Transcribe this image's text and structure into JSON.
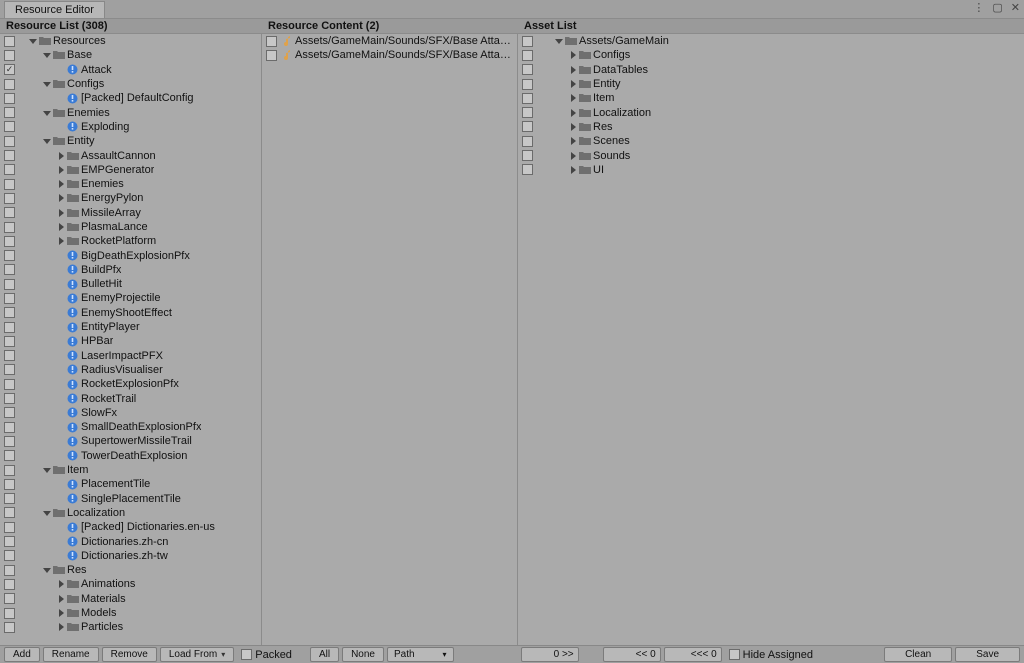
{
  "window": {
    "title": "Resource Editor"
  },
  "headers": {
    "list": "Resource List (308)",
    "content": "Resource Content (2)",
    "asset": "Asset List"
  },
  "resourceList": [
    {
      "depth": 0,
      "cb": false,
      "expand": "down",
      "icon": "folder",
      "label": "Resources"
    },
    {
      "depth": 1,
      "cb": false,
      "expand": "down",
      "icon": "folder",
      "label": "Base"
    },
    {
      "depth": 2,
      "cb": true,
      "expand": "none",
      "icon": "blue",
      "label": "Attack"
    },
    {
      "depth": 1,
      "cb": false,
      "expand": "down",
      "icon": "folder",
      "label": "Configs"
    },
    {
      "depth": 2,
      "cb": false,
      "expand": "none",
      "icon": "blue",
      "label": "[Packed] DefaultConfig"
    },
    {
      "depth": 1,
      "cb": false,
      "expand": "down",
      "icon": "folder",
      "label": "Enemies"
    },
    {
      "depth": 2,
      "cb": false,
      "expand": "none",
      "icon": "blue",
      "label": "Exploding"
    },
    {
      "depth": 1,
      "cb": false,
      "expand": "down",
      "icon": "folder",
      "label": "Entity"
    },
    {
      "depth": 2,
      "cb": false,
      "expand": "right",
      "icon": "folder",
      "label": "AssaultCannon"
    },
    {
      "depth": 2,
      "cb": false,
      "expand": "right",
      "icon": "folder",
      "label": "EMPGenerator"
    },
    {
      "depth": 2,
      "cb": false,
      "expand": "right",
      "icon": "folder",
      "label": "Enemies"
    },
    {
      "depth": 2,
      "cb": false,
      "expand": "right",
      "icon": "folder",
      "label": "EnergyPylon"
    },
    {
      "depth": 2,
      "cb": false,
      "expand": "right",
      "icon": "folder",
      "label": "MissileArray"
    },
    {
      "depth": 2,
      "cb": false,
      "expand": "right",
      "icon": "folder",
      "label": "PlasmaLance"
    },
    {
      "depth": 2,
      "cb": false,
      "expand": "right",
      "icon": "folder",
      "label": "RocketPlatform"
    },
    {
      "depth": 2,
      "cb": false,
      "expand": "none",
      "icon": "blue",
      "label": "BigDeathExplosionPfx"
    },
    {
      "depth": 2,
      "cb": false,
      "expand": "none",
      "icon": "blue",
      "label": "BuildPfx"
    },
    {
      "depth": 2,
      "cb": false,
      "expand": "none",
      "icon": "blue",
      "label": "BulletHit"
    },
    {
      "depth": 2,
      "cb": false,
      "expand": "none",
      "icon": "blue",
      "label": "EnemyProjectile"
    },
    {
      "depth": 2,
      "cb": false,
      "expand": "none",
      "icon": "blue",
      "label": "EnemyShootEffect"
    },
    {
      "depth": 2,
      "cb": false,
      "expand": "none",
      "icon": "blue",
      "label": "EntityPlayer"
    },
    {
      "depth": 2,
      "cb": false,
      "expand": "none",
      "icon": "blue",
      "label": "HPBar"
    },
    {
      "depth": 2,
      "cb": false,
      "expand": "none",
      "icon": "blue",
      "label": "LaserImpactPFX"
    },
    {
      "depth": 2,
      "cb": false,
      "expand": "none",
      "icon": "blue",
      "label": "RadiusVisualiser"
    },
    {
      "depth": 2,
      "cb": false,
      "expand": "none",
      "icon": "blue",
      "label": "RocketExplosionPfx"
    },
    {
      "depth": 2,
      "cb": false,
      "expand": "none",
      "icon": "blue",
      "label": "RocketTrail"
    },
    {
      "depth": 2,
      "cb": false,
      "expand": "none",
      "icon": "blue",
      "label": "SlowFx"
    },
    {
      "depth": 2,
      "cb": false,
      "expand": "none",
      "icon": "blue",
      "label": "SmallDeathExplosionPfx"
    },
    {
      "depth": 2,
      "cb": false,
      "expand": "none",
      "icon": "blue",
      "label": "SupertowerMissileTrail"
    },
    {
      "depth": 2,
      "cb": false,
      "expand": "none",
      "icon": "blue",
      "label": "TowerDeathExplosion"
    },
    {
      "depth": 1,
      "cb": false,
      "expand": "down",
      "icon": "folder",
      "label": "Item"
    },
    {
      "depth": 2,
      "cb": false,
      "expand": "none",
      "icon": "blue",
      "label": "PlacementTile"
    },
    {
      "depth": 2,
      "cb": false,
      "expand": "none",
      "icon": "blue",
      "label": "SinglePlacementTile"
    },
    {
      "depth": 1,
      "cb": false,
      "expand": "down",
      "icon": "folder",
      "label": "Localization"
    },
    {
      "depth": 2,
      "cb": false,
      "expand": "none",
      "icon": "blue",
      "label": "[Packed] Dictionaries.en-us"
    },
    {
      "depth": 2,
      "cb": false,
      "expand": "none",
      "icon": "blue",
      "label": "Dictionaries.zh-cn"
    },
    {
      "depth": 2,
      "cb": false,
      "expand": "none",
      "icon": "blue",
      "label": "Dictionaries.zh-tw"
    },
    {
      "depth": 1,
      "cb": false,
      "expand": "down",
      "icon": "folder",
      "label": "Res"
    },
    {
      "depth": 2,
      "cb": false,
      "expand": "right",
      "icon": "folder",
      "label": "Animations"
    },
    {
      "depth": 2,
      "cb": false,
      "expand": "right",
      "icon": "folder",
      "label": "Materials"
    },
    {
      "depth": 2,
      "cb": false,
      "expand": "right",
      "icon": "folder",
      "label": "Models"
    },
    {
      "depth": 2,
      "cb": false,
      "expand": "right",
      "icon": "folder",
      "label": "Particles"
    }
  ],
  "resourceContent": [
    {
      "cb": false,
      "icon": "audio",
      "label": "Assets/GameMain/Sounds/SFX/Base Attack/base_atta"
    },
    {
      "cb": false,
      "icon": "audio",
      "label": "Assets/GameMain/Sounds/SFX/Base Attack/zone_ent"
    }
  ],
  "assetList": [
    {
      "depth": 0,
      "cb": false,
      "expand": "down",
      "icon": "folder",
      "label": "Assets/GameMain"
    },
    {
      "depth": 1,
      "cb": false,
      "expand": "right",
      "icon": "folder",
      "label": "Configs"
    },
    {
      "depth": 1,
      "cb": false,
      "expand": "right",
      "icon": "folder",
      "label": "DataTables"
    },
    {
      "depth": 1,
      "cb": false,
      "expand": "right",
      "icon": "folder",
      "label": "Entity"
    },
    {
      "depth": 1,
      "cb": false,
      "expand": "right",
      "icon": "folder",
      "label": "Item"
    },
    {
      "depth": 1,
      "cb": false,
      "expand": "right",
      "icon": "folder",
      "label": "Localization"
    },
    {
      "depth": 1,
      "cb": false,
      "expand": "right",
      "icon": "folder",
      "label": "Res"
    },
    {
      "depth": 1,
      "cb": false,
      "expand": "right",
      "icon": "folder",
      "label": "Scenes"
    },
    {
      "depth": 1,
      "cb": false,
      "expand": "right",
      "icon": "folder",
      "label": "Sounds"
    },
    {
      "depth": 1,
      "cb": false,
      "expand": "right",
      "icon": "folder",
      "label": "UI"
    }
  ],
  "toolbar": {
    "add": "Add",
    "rename": "Rename",
    "remove": "Remove",
    "loadFrom": "Load From",
    "packed": "Packed",
    "all": "All",
    "none": "None",
    "path": "Path",
    "pager": "0 >>",
    "prev1": "<< 0",
    "prev2": "<<< 0",
    "hideAssigned": "Hide Assigned",
    "clean": "Clean",
    "save": "Save"
  }
}
